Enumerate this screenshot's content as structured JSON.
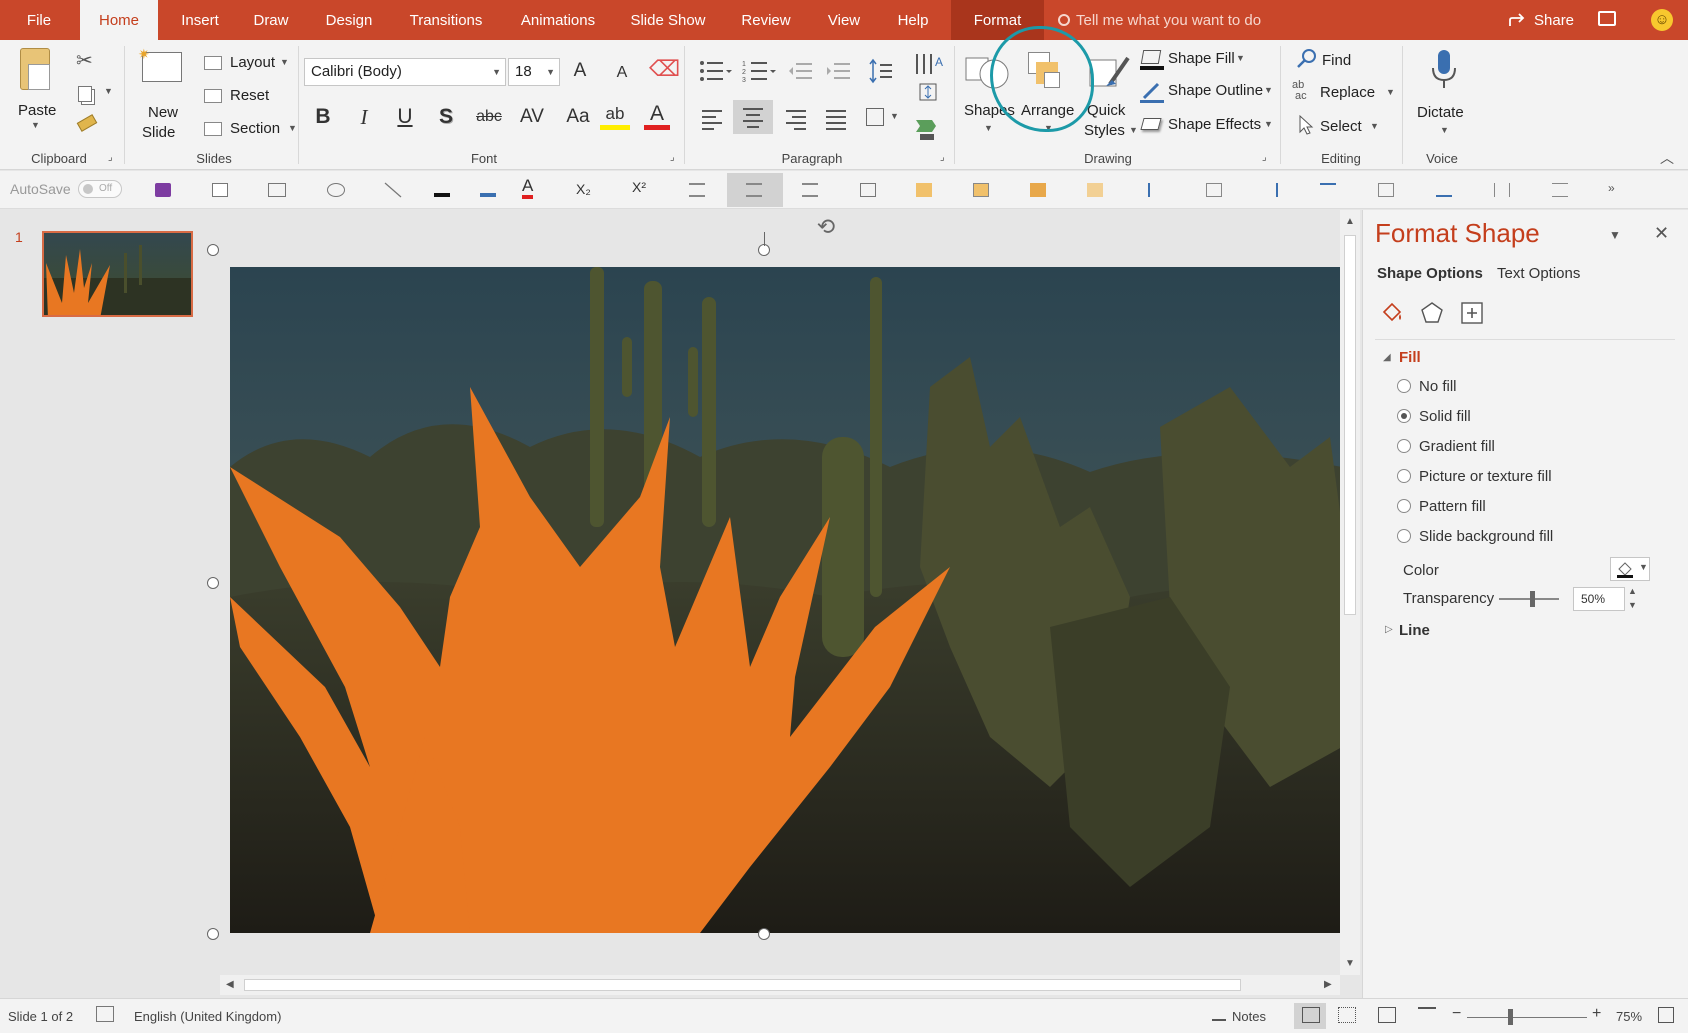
{
  "tabs": {
    "file": "File",
    "home": "Home",
    "insert": "Insert",
    "draw": "Draw",
    "design": "Design",
    "transitions": "Transitions",
    "animations": "Animations",
    "slideshow": "Slide Show",
    "review": "Review",
    "view": "View",
    "help": "Help",
    "format": "Format"
  },
  "tellme_placeholder": "Tell me what you want to do",
  "share_label": "Share",
  "ribbon": {
    "clipboard": {
      "label": "Clipboard",
      "paste": "Paste"
    },
    "slides": {
      "label": "Slides",
      "new_slide_line1": "New",
      "new_slide_line2": "Slide",
      "layout": "Layout",
      "reset": "Reset",
      "section": "Section"
    },
    "font": {
      "label": "Font",
      "font_name": "Calibri (Body)",
      "font_size": "18",
      "bold": "B",
      "italic": "I",
      "underline": "U",
      "shadow": "S",
      "strike": "abc",
      "spacing": "AV",
      "case": "Aa",
      "highlight": "ab",
      "color": "A",
      "grow": "A",
      "shrink": "A"
    },
    "paragraph": {
      "label": "Paragraph"
    },
    "drawing": {
      "label": "Drawing",
      "shapes": "Shapes",
      "arrange": "Arrange",
      "quick_line1": "Quick",
      "quick_line2": "Styles",
      "shape_fill": "Shape Fill",
      "shape_outline": "Shape Outline",
      "shape_effects": "Shape Effects"
    },
    "editing": {
      "label": "Editing",
      "find": "Find",
      "replace": "Replace",
      "select": "Select"
    },
    "voice": {
      "label": "Voice",
      "dictate": "Dictate"
    }
  },
  "qat": {
    "autosave": "AutoSave",
    "toggle": "Off",
    "subscript": "X₂",
    "superscript": "X²"
  },
  "slides_panel": {
    "slide_number": "1"
  },
  "pane": {
    "title": "Format Shape",
    "tab_shape": "Shape Options",
    "tab_text": "Text Options",
    "fill_header": "Fill",
    "fill_options": [
      {
        "label": "No fill",
        "selected": false
      },
      {
        "label": "Solid fill",
        "selected": true
      },
      {
        "label": "Gradient fill",
        "selected": false
      },
      {
        "label": "Picture or texture fill",
        "selected": false
      },
      {
        "label": "Pattern fill",
        "selected": false
      },
      {
        "label": "Slide background fill",
        "selected": false
      }
    ],
    "color_label": "Color",
    "transparency_label": "Transparency",
    "transparency_value": "50%",
    "line_header": "Line"
  },
  "status": {
    "slide_info": "Slide 1 of 2",
    "language": "English (United Kingdom)",
    "notes": "Notes",
    "zoom": "75%"
  },
  "colors": {
    "accent": "#c43e1c",
    "tabbar": "#c9472a",
    "shape_fill": "#e87722",
    "annotation": "#1c9aa8"
  }
}
